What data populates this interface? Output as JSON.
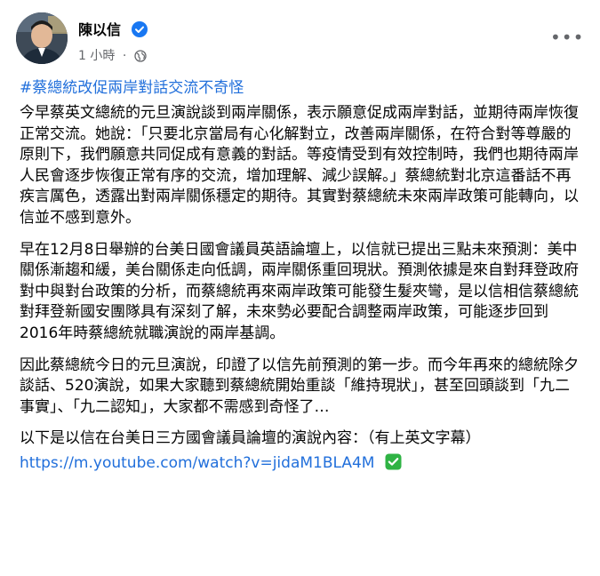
{
  "post": {
    "author": "陳以信",
    "timestamp": "1 小時",
    "separator": "·",
    "more_label": "•••",
    "hashtag": "#蔡總統改促兩岸對話交流不奇怪",
    "paragraphs": [
      "今早蔡英文總統的元旦演說談到兩岸關係，表示願意促成兩岸對話，並期待兩岸恢復正常交流。她說：「只要北京當局有心化解對立，改善兩岸關係，在符合對等尊嚴的原則下，我們願意共同促成有意義的對話。等疫情受到有效控制時，我們也期待兩岸人民會逐步恢復正常有序的交流，增加理解、減少誤解。」蔡總統對北京這番話不再疾言厲色，透露出對兩岸關係穩定的期待。其實對蔡總統未來兩岸政策可能轉向，以信並不感到意外。",
      "早在12月8日舉辦的台美日國會議員英語論壇上，以信就已提出三點未來預測：美中關係漸趨和緩，美台關係走向低調，兩岸關係重回現狀。預測依據是來自對拜登政府對中與對台政策的分析，而蔡總統再來兩岸政策可能發生髮夾彎，是以信相信蔡總統對拜登新國安團隊具有深刻了解，未來勢必要配合調整兩岸政策，可能逐步回到2016年時蔡總統就職演說的兩岸基調。",
      "因此蔡總統今日的元旦演說，印證了以信先前預測的第一步。而今年再來的總統除夕談話、520演說，如果大家聽到蔡總統開始重談「維持現狀」，甚至回頭談到「九二事實」、「九二認知」，大家都不需感到奇怪了…",
      "以下是以信在台美日三方國會議員論壇的演說內容：（有上英文字幕）"
    ],
    "link": "https://m.youtube.com/watch?v=jidaM1BLA4M",
    "icons": {
      "verified": "verified-badge-icon",
      "privacy": "globe-icon",
      "link_check": "check-circle-icon"
    },
    "colors": {
      "link": "#216fdb",
      "verified": "#1877f2",
      "check": "#2fb344",
      "secondary_text": "#65676b"
    }
  }
}
